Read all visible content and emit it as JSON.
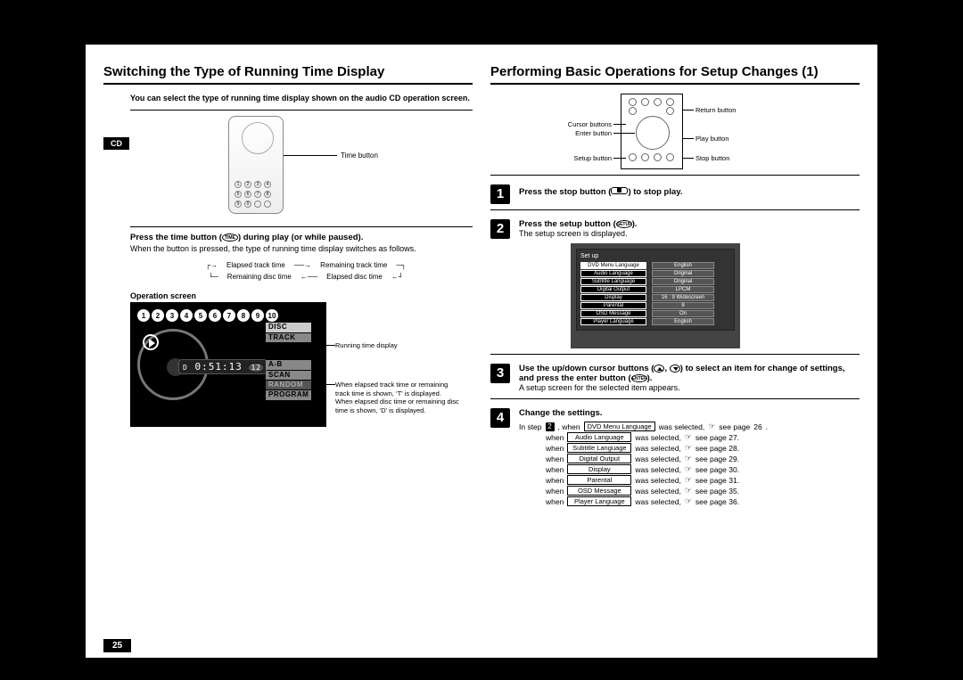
{
  "pageNumber": "25",
  "left": {
    "title": "Switching the Type of Running Time Display",
    "intro": "You can select the type of running time display shown on the audio CD operation screen.",
    "cdTag": "CD",
    "timeButtonLabel": "Time button",
    "step1_head_a": "Press the time button (",
    "step1_head_b": ") during play (or while paused).",
    "step1_body": "When the button is pressed, the type of running time display switches as follows.",
    "cycle": {
      "a": "Elapsed track time",
      "b": "Remaining track time",
      "c": "Remaining disc time",
      "d": "Elapsed disc time"
    },
    "operationScreen": "Operation screen",
    "trackNums": [
      "1",
      "2",
      "3",
      "4",
      "5",
      "6",
      "7",
      "8",
      "9",
      "10"
    ],
    "timeValue": "0:51:13",
    "dIndicator": "D",
    "trackIndicator": "12",
    "tags": {
      "disc": "DISC",
      "track": "TRACK",
      "ab": "A-B",
      "scan": "SCAN",
      "random": "RANDOM",
      "program": "PROGRAM"
    },
    "callout_running": "Running time display",
    "callout_elapsed": "When elapsed track time or remaining track time is shown, ‘T’ is displayed.\nWhen elapsed disc time or remaining disc time is shown, ‘D’ is displayed."
  },
  "right": {
    "title": "Performing Basic Operations for Setup Changes (1)",
    "labels": {
      "cursor": "Cursor buttons",
      "enter": "Enter button",
      "setup": "Setup button",
      "return": "Return button",
      "play": "Play button",
      "stop": "Stop button"
    },
    "step1_a": "Press the stop button (",
    "step1_b": ") to stop play.",
    "step2_a": "Press the setup button (",
    "step2_b": ").",
    "step2_body": "The setup screen is displayed.",
    "setupTitle": "Set up",
    "setupRows": [
      {
        "k": "DVD Menu Language",
        "v": "English",
        "sel": true
      },
      {
        "k": "Audio Language",
        "v": "Original"
      },
      {
        "k": "Subtitle Language",
        "v": "Original"
      },
      {
        "k": "Digital Output",
        "v": "LPCM"
      },
      {
        "k": "Display",
        "v": "16 : 9 Widescreen"
      },
      {
        "k": "Parental",
        "v": "8"
      },
      {
        "k": "OSD Message",
        "v": "On"
      },
      {
        "k": "Player Language",
        "v": "English"
      }
    ],
    "step3_a": "Use the up/down cursor buttons (",
    "step3_mid": ", ",
    "step3_b": ") to select an item for change of settings, and press the enter button (",
    "step3_c": ").",
    "step3_body": "A setup screen for the selected item appears.",
    "step4_head": "Change the settings.",
    "step4_intro_a": "In step ",
    "step4_intro_b": " , when",
    "refWhen": "when",
    "refSelected": "was selected,",
    "refSee": "see page",
    "refs": [
      {
        "label": "DVD Menu Language",
        "page": "26"
      },
      {
        "label": "Audio Language",
        "page": "27"
      },
      {
        "label": "Subtitle Language",
        "page": "28"
      },
      {
        "label": "Digital Output",
        "page": "29"
      },
      {
        "label": "Display",
        "page": "30"
      },
      {
        "label": "Parental",
        "page": "31"
      },
      {
        "label": "OSD Message",
        "page": "35"
      },
      {
        "label": "Player Language",
        "page": "36"
      }
    ]
  }
}
